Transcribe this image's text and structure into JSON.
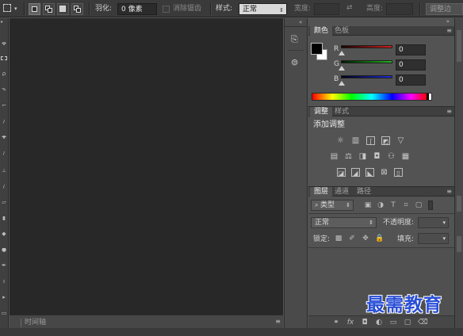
{
  "options_bar": {
    "feather_label": "羽化:",
    "feather_value": "0 像素",
    "antialias_label": "消除锯齿",
    "style_label": "样式:",
    "style_value": "正常",
    "width_label": "宽度:",
    "height_label": "高度:",
    "refine_edge_button": "调整边"
  },
  "canvas": {
    "timeline_tab": "时间轴"
  },
  "color_panel": {
    "tabs": [
      "颜色",
      "色板"
    ],
    "channels": [
      {
        "label": "R",
        "value": "0"
      },
      {
        "label": "G",
        "value": "0"
      },
      {
        "label": "B",
        "value": "0"
      }
    ],
    "colors": {
      "foreground": "#000000",
      "background": "#ffffff",
      "r_track": "#c42020",
      "g_track": "#1fa01f",
      "b_track": "#1f2fc4"
    }
  },
  "adjust_panel": {
    "tabs": [
      "调整",
      "样式"
    ],
    "heading": "添加调整",
    "icons_row1": [
      "brightness-icon",
      "levels-icon",
      "curves-icon",
      "exposure-icon",
      "vibrance-icon"
    ],
    "icons_row2": [
      "hue-saturation-icon",
      "color-balance-icon",
      "black-white-icon",
      "photo-filter-icon",
      "channel-mixer-icon",
      "color-lookup-icon"
    ],
    "icons_row3": [
      "invert-icon",
      "posterize-icon",
      "threshold-icon",
      "selective-color-icon",
      "gradient-map-icon"
    ]
  },
  "layers_panel": {
    "tabs": [
      "图层",
      "通道",
      "路径"
    ],
    "filter_label": "类型",
    "blend_mode": "正常",
    "opacity_label": "不透明度:",
    "lock_label": "锁定:",
    "fill_label": "填充:",
    "footer_icons": [
      "link-icon",
      "fx-icon",
      "mask-icon",
      "adjustment-icon",
      "group-icon",
      "new-layer-icon",
      "trash-icon"
    ]
  },
  "watermark": "最需教育"
}
